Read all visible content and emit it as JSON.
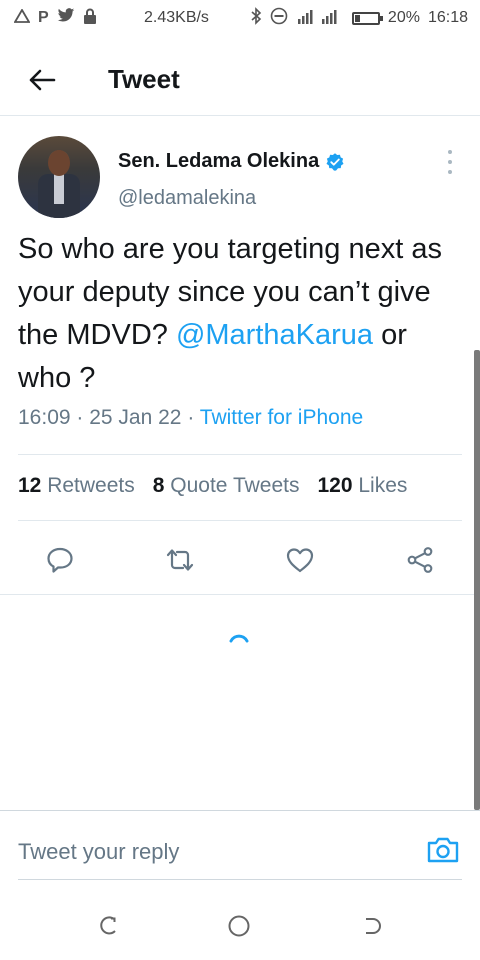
{
  "status_bar": {
    "left_icons": [
      "warning-icon",
      "p-icon",
      "twitter-icon",
      "lock-icon"
    ],
    "speed": "2.43KB/s",
    "battery": "20%",
    "time": "16:18"
  },
  "header": {
    "title": "Tweet"
  },
  "tweet": {
    "author_name": "Sen. Ledama Olekina",
    "handle": "@ledamalekina",
    "text_before": "So who are you targeting next as your deputy since you can’t give the MDVD? ",
    "mention": "@MarthaKarua",
    "text_after": " or who ?",
    "time": "16:09",
    "date": "25 Jan 22",
    "source": "Twitter for iPhone"
  },
  "stats": {
    "retweets_count": "12",
    "retweets_label": "Retweets",
    "quotes_count": "8",
    "quotes_label": "Quote Tweets",
    "likes_count": "120",
    "likes_label": "Likes"
  },
  "reply": {
    "placeholder": "Tweet your reply"
  },
  "colors": {
    "accent": "#1da1f2",
    "secondary_text": "#657786",
    "divider": "#e1e8ed"
  }
}
